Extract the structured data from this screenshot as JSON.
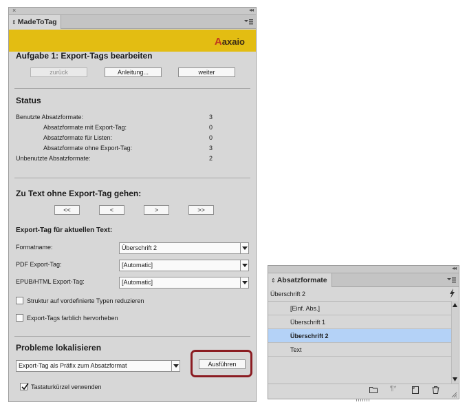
{
  "madetotag": {
    "tab_label": "MadeToTag",
    "brand": "axaio",
    "task_title": "Aufgabe 1: Export-Tags bearbeiten",
    "buttons": {
      "back": "zurück",
      "help": "Anleitung...",
      "next": "weiter"
    },
    "status": {
      "title": "Status",
      "rows": [
        {
          "label": "Benutzte Absatzformate:",
          "value": "3"
        },
        {
          "label": "Absatzformate mit Export-Tag:",
          "value": "0"
        },
        {
          "label": "Absatzformate für Listen:",
          "value": "0"
        },
        {
          "label": "Absatzformate ohne Export-Tag:",
          "value": "3"
        },
        {
          "label": "Unbenutzte Absatzformate:",
          "value": "2"
        }
      ]
    },
    "goto": {
      "title": "Zu Text ohne Export-Tag gehen:",
      "buttons": [
        "<<",
        "<",
        ">",
        ">>"
      ]
    },
    "export_tag": {
      "title": "Export-Tag für aktuellen Text:",
      "format_label": "Formatname:",
      "format_value": "Überschrift 2",
      "pdf_label": "PDF Export-Tag:",
      "pdf_value": "[Automatic]",
      "epub_label": "EPUB/HTML Export-Tag:",
      "epub_value": "[Automatic]",
      "checkbox_structure": "Struktur auf vordefinierte Typen reduzieren",
      "checkbox_highlight": "Export-Tags farblich hervorheben"
    },
    "problems": {
      "title": "Probleme lokalisieren",
      "dropdown_value": "Export-Tag als Präfix zum Absatzformat",
      "run_button": "Ausführen",
      "shortcuts_label": "Tastaturkürzel verwenden"
    }
  },
  "absatzformate": {
    "tab_label": "Absatzformate",
    "current": "Überschrift 2",
    "items": [
      "[Einf. Abs.]",
      "Überschrift 1",
      "Überschrift 2",
      "Text"
    ],
    "selected_index": 2
  },
  "colors": {
    "brand_bar": "#e3bd12",
    "highlight_ring": "#8b1c22",
    "selection": "#b4d2f7"
  }
}
